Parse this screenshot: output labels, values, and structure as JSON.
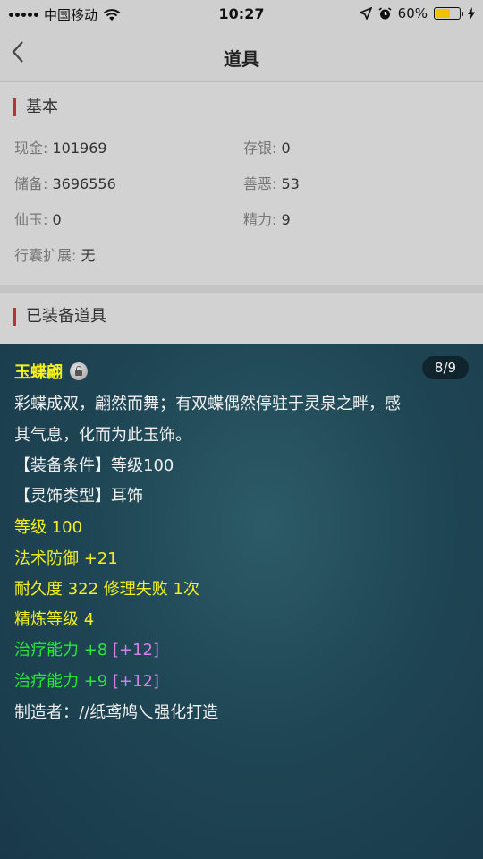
{
  "status": {
    "carrier": "中国移动",
    "time": "10:27",
    "battery": "60%",
    "battery_level": 0.6
  },
  "nav": {
    "back_icon": "chevron-left-icon",
    "title": "道具"
  },
  "basic": {
    "title": "基本",
    "cash_label": "现金:",
    "cash_value": "101969",
    "savings_label": "存银:",
    "savings_value": "0",
    "reserve_label": "储备:",
    "reserve_value": "3696556",
    "morality_label": "善恶:",
    "morality_value": "53",
    "jade_label": "仙玉:",
    "jade_value": "0",
    "energy_label": "精力:",
    "energy_value": "9",
    "bag_label": "行囊扩展:",
    "bag_value": "无"
  },
  "equipped": {
    "title": "已装备道具"
  },
  "item": {
    "name": "玉蝶翩",
    "page": "8/9",
    "desc_line1": "彩蝶成双，翩然而舞；有双蝶偶然停驻于灵泉之畔，感",
    "desc_line2": "其气息，化而为此玉饰。",
    "cond": "【装备条件】等级100",
    "type": "【灵饰类型】耳饰",
    "level": "等级 100",
    "magic_def": "法术防御 +21",
    "durability": "耐久度 322 修理失败 1次",
    "refine": "精炼等级 4",
    "heal1": "治疗能力 +8",
    "heal1_bonus": "[+12]",
    "heal2": "治疗能力 +9",
    "heal2_bonus": "[+12]",
    "maker": "制造者：//纸鸢鸠乀强化打造"
  },
  "colors": {
    "accent_bar": "#b5353a",
    "yellow_text": "#f4f020",
    "green_text": "#27e63a",
    "purple_text": "#d57de8",
    "battery_fill": "#f2c200"
  }
}
